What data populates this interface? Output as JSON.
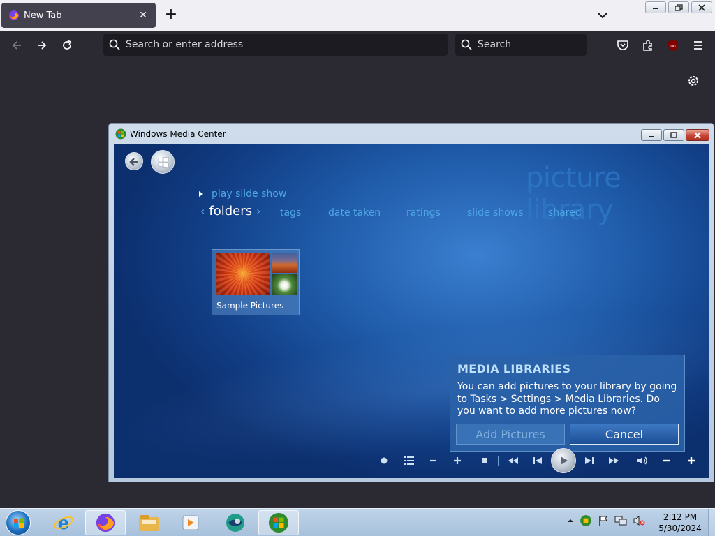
{
  "browser": {
    "tab_title": "New Tab",
    "address_placeholder": "Search or enter address",
    "search_placeholder": "Search"
  },
  "wmc": {
    "window_title": "Windows Media Center",
    "library_title": "picture library",
    "play_slide_show": "play slide show",
    "menu": {
      "active": "folders",
      "items": [
        "tags",
        "date taken",
        "ratings",
        "slide shows",
        "shared"
      ]
    },
    "folder": {
      "label": "Sample Pictures"
    },
    "dialog": {
      "title": "MEDIA LIBRARIES",
      "body": "You can add pictures to your library by going to Tasks > Settings > Media Libraries. Do you want to add more pictures now?",
      "add_label": "Add Pictures",
      "cancel_label": "Cancel"
    }
  },
  "taskbar": {
    "time": "2:12 PM",
    "date": "5/30/2024"
  },
  "colors": {
    "wmc_accent": "#4fa7e6",
    "firefox_dark": "#2b2a33"
  }
}
